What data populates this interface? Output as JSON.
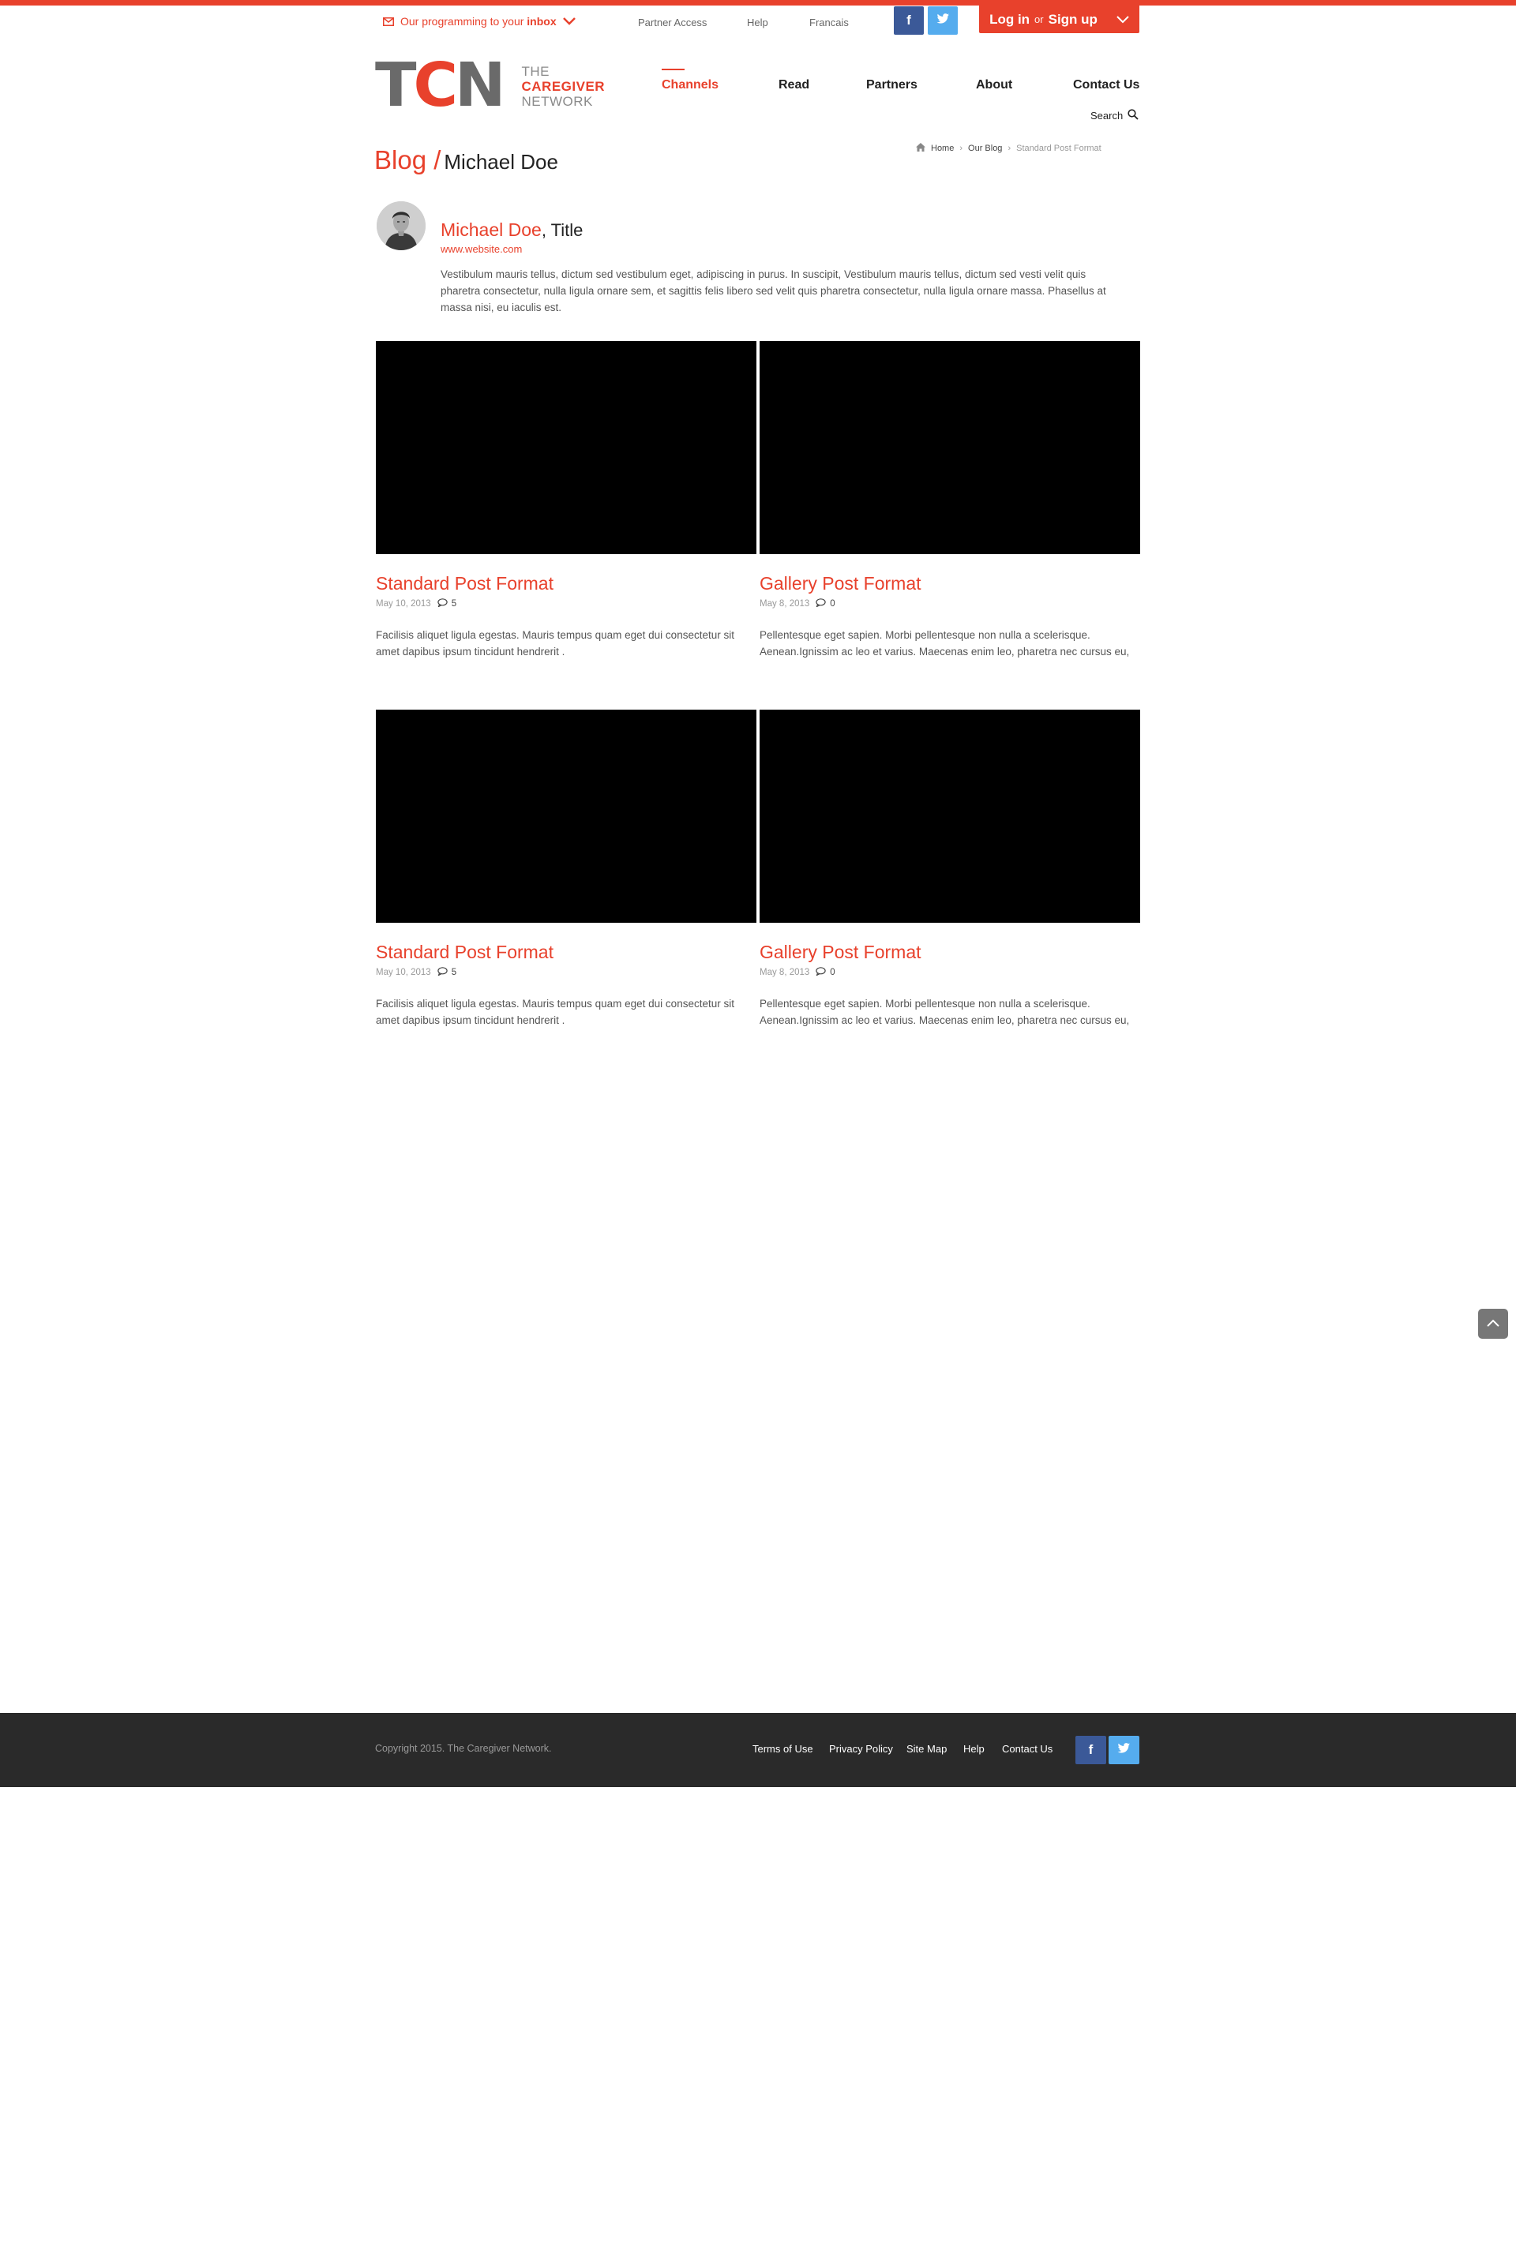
{
  "top_bar": {
    "inbox_text": "Our programming to your",
    "inbox_bold": "inbox",
    "links": [
      "Partner Access",
      "Help",
      "Francais"
    ],
    "facebook_glyph": "f",
    "login_label": "Log in",
    "or_label": "or",
    "signup_label": "Sign up"
  },
  "logo": {
    "mark_gray1": "T",
    "mark_red": "C",
    "mark_gray2": "N",
    "line1": "THE",
    "line2": "CAREGIVER",
    "line3": "NETWORK"
  },
  "nav": {
    "items": [
      "Channels",
      "Read",
      "Partners",
      "About",
      "Contact Us"
    ],
    "active": "Channels",
    "search_label": "Search"
  },
  "page": {
    "section": "Blog /",
    "subtitle": "Michael Doe"
  },
  "breadcrumb": {
    "home": "Home",
    "blog": "Our Blog",
    "current": "Standard Post Format"
  },
  "author": {
    "name": "Michael Doe",
    "title_suffix": ", Title",
    "website": "www.website.com",
    "bio": "Vestibulum mauris tellus, dictum sed vestibulum eget, adipiscing in purus. In suscipit, Vestibulum mauris tellus, dictum sed vesti velit quis pharetra consectetur, nulla ligula ornare sem, et sagittis felis libero sed  velit quis pharetra consectetur, nulla ligula ornare massa. Phasellus at massa nisi, eu iaculis est."
  },
  "posts": [
    {
      "title": "Standard Post Format",
      "date": "May 10, 2013",
      "comments": "5",
      "excerpt": "Facilisis aliquet ligula egestas. Mauris tempus quam eget dui consectetur sit amet dapibus ipsum tincidunt hendrerit ."
    },
    {
      "title": "Gallery Post Format",
      "date": "May 8, 2013",
      "comments": "0",
      "excerpt": "Pellentesque eget sapien. Morbi pellentesque non nulla a scelerisque. Aenean.Ignissim ac leo et varius. Maecenas enim leo, pharetra nec cursus eu,"
    },
    {
      "title": "Standard Post Format",
      "date": "May 10, 2013",
      "comments": "5",
      "excerpt": "Facilisis aliquet ligula egestas. Mauris tempus quam eget dui consectetur sit amet dapibus ipsum tincidunt hendrerit ."
    },
    {
      "title": "Gallery Post Format",
      "date": "May 8, 2013",
      "comments": "0",
      "excerpt": "Pellentesque eget sapien. Morbi pellentesque non nulla a scelerisque. Aenean.Ignissim ac leo et varius. Maecenas enim leo, pharetra nec cursus eu,"
    }
  ],
  "footer": {
    "copyright": "Copyright 2015. The Caregiver Network.",
    "links": [
      "Terms of Use",
      "Privacy Policy",
      "Site Map",
      "Help",
      "Contact Us"
    ]
  },
  "icons": {
    "inbox": "envelope-icon",
    "inbox_chevron": "chevron-down-icon",
    "facebook": "facebook-icon",
    "twitter": "twitter-icon",
    "login_chevron": "chevron-down-icon",
    "search": "search-icon",
    "home": "home-icon",
    "breadcrumb_sep": "chevron-right-icon",
    "comments": "comment-icon",
    "scroll_top": "chevron-up-icon"
  },
  "colors": {
    "accent": "#e8412c",
    "facebook": "#3b5998",
    "twitter": "#55acee",
    "footer_bg": "#2a2a2a"
  }
}
